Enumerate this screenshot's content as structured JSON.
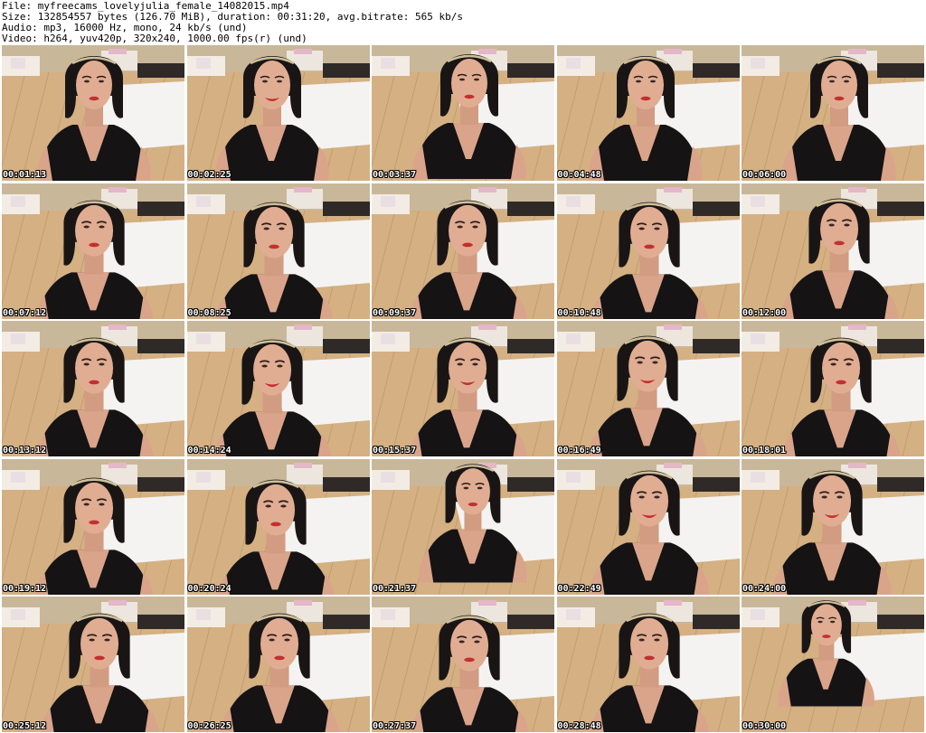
{
  "header": {
    "file_line": "File: myfreecams_lovelyjulia_female_14082015.mp4",
    "size_line": "Size: 132854557 bytes (126.70 MiB), duration: 00:31:20, avg.bitrate: 565 kb/s",
    "audio_line": "Audio: mp3, 16000 Hz, mono, 24 kb/s (und)",
    "video_line": "Video: h264, yuv420p, 320x240, 1000.00 fps(r) (und)"
  },
  "thumbnails": [
    {
      "timestamp": "00:01:13"
    },
    {
      "timestamp": "00:02:25"
    },
    {
      "timestamp": "00:03:37"
    },
    {
      "timestamp": "00:04:48"
    },
    {
      "timestamp": "00:06:00"
    },
    {
      "timestamp": "00:07:12"
    },
    {
      "timestamp": "00:08:25"
    },
    {
      "timestamp": "00:09:37"
    },
    {
      "timestamp": "00:10:48"
    },
    {
      "timestamp": "00:12:00"
    },
    {
      "timestamp": "00:13:12"
    },
    {
      "timestamp": "00:14:24"
    },
    {
      "timestamp": "00:15:37"
    },
    {
      "timestamp": "00:16:49"
    },
    {
      "timestamp": "00:18:01"
    },
    {
      "timestamp": "00:19:12"
    },
    {
      "timestamp": "00:20:24"
    },
    {
      "timestamp": "00:21:37"
    },
    {
      "timestamp": "00:22:49"
    },
    {
      "timestamp": "00:24:00"
    },
    {
      "timestamp": "00:25:12"
    },
    {
      "timestamp": "00:26:25"
    },
    {
      "timestamp": "00:27:37"
    },
    {
      "timestamp": "00:28:48"
    },
    {
      "timestamp": "00:30:00"
    }
  ],
  "colors": {
    "background": "#ffffff",
    "header_text": "#000000",
    "timestamp_text": "#ffffff",
    "timestamp_outline": "#000000"
  }
}
